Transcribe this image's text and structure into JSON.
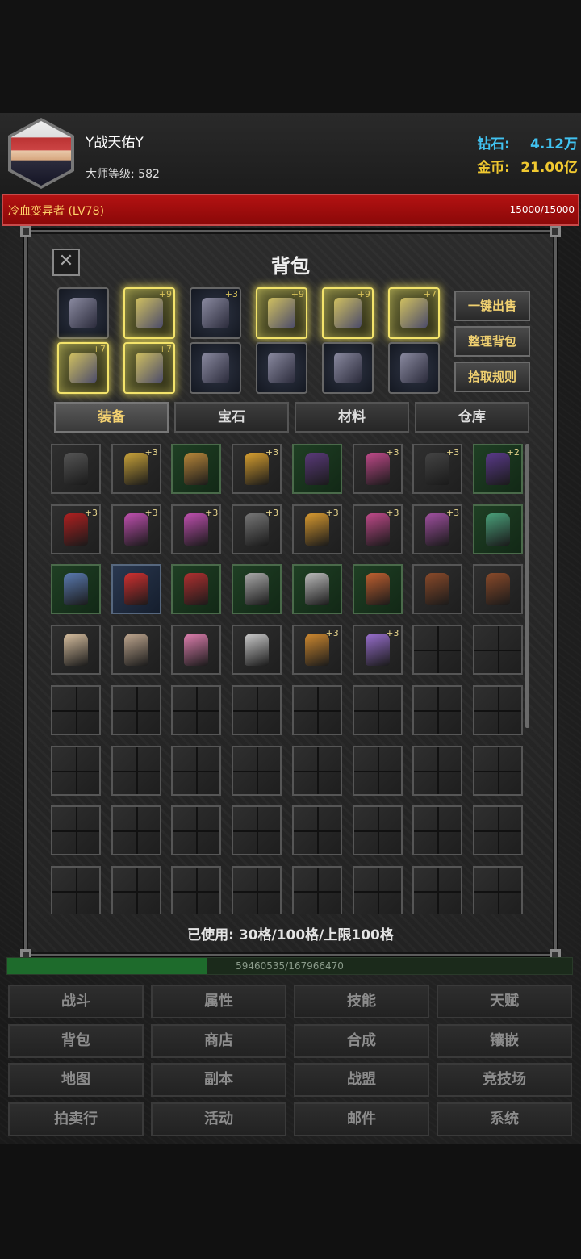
{
  "player": {
    "name": "Y战天佑Y",
    "level_label": "大师等级:",
    "level_value": "582"
  },
  "currency": {
    "diamond_label": "钻石:",
    "diamond_value": "4.12万",
    "gold_label": "金币:",
    "gold_value": "21.00亿",
    "diamond_color": "#41c2f0",
    "gold_color": "#f0c830"
  },
  "enemy": {
    "name": "冷血变异者 (LV78)",
    "hp": "15000/15000"
  },
  "bag": {
    "title": "背包",
    "close_icon": "close-icon",
    "equipped": [
      {
        "name": "helmet",
        "plus": "",
        "glow": false
      },
      {
        "name": "chest-armor",
        "plus": "+9",
        "glow": true
      },
      {
        "name": "leg-armor",
        "plus": "+3",
        "glow": false
      },
      {
        "name": "gloves",
        "plus": "+9",
        "glow": true
      },
      {
        "name": "boots",
        "plus": "+9",
        "glow": true
      },
      {
        "name": "wings",
        "plus": "+7",
        "glow": true
      },
      {
        "name": "weapon-left",
        "plus": "+7",
        "glow": true
      },
      {
        "name": "weapon-right",
        "plus": "+7",
        "glow": true
      },
      {
        "name": "necklace",
        "plus": "",
        "glow": false
      },
      {
        "name": "ring-left",
        "plus": "",
        "glow": false
      },
      {
        "name": "ring-right",
        "plus": "",
        "glow": false
      },
      {
        "name": "pet",
        "plus": "",
        "glow": false
      }
    ],
    "actions": {
      "sell_all": "一键出售",
      "sort": "整理背包",
      "pickup_rules": "拾取规则"
    },
    "tabs": [
      "装备",
      "宝石",
      "材料",
      "仓库"
    ],
    "active_tab": 0,
    "items": [
      {
        "name": "wings",
        "plus": "",
        "bg": "normal",
        "color": "#555"
      },
      {
        "name": "gold-armor",
        "plus": "+3",
        "bg": "normal",
        "color": "#c9a33a"
      },
      {
        "name": "gold-armor",
        "plus": "",
        "bg": "green",
        "color": "#b8873a"
      },
      {
        "name": "helm-gold",
        "plus": "+3",
        "bg": "normal",
        "color": "#d8a030"
      },
      {
        "name": "purple-armor",
        "plus": "",
        "bg": "green",
        "color": "#5a3a7a"
      },
      {
        "name": "pink-armor",
        "plus": "+3",
        "bg": "normal",
        "color": "#c04a8a"
      },
      {
        "name": "dark-pants",
        "plus": "+3",
        "bg": "normal",
        "color": "#444"
      },
      {
        "name": "purple-pants",
        "plus": "+2",
        "bg": "green",
        "color": "#5a3a8a"
      },
      {
        "name": "red-pants",
        "plus": "+3",
        "bg": "normal",
        "color": "#b02020"
      },
      {
        "name": "pink-gloves",
        "plus": "+3",
        "bg": "normal",
        "color": "#c050b0"
      },
      {
        "name": "pink-gloves",
        "plus": "+3",
        "bg": "normal",
        "color": "#c050b0"
      },
      {
        "name": "dark-gloves",
        "plus": "+3",
        "bg": "normal",
        "color": "#777"
      },
      {
        "name": "gold-gloves",
        "plus": "+3",
        "bg": "normal",
        "color": "#d89a30"
      },
      {
        "name": "pink-boots",
        "plus": "+3",
        "bg": "normal",
        "color": "#c04a8a"
      },
      {
        "name": "purple-boots",
        "plus": "+3",
        "bg": "normal",
        "color": "#a050a0"
      },
      {
        "name": "green-claw",
        "plus": "",
        "bg": "green",
        "color": "#4aa07a"
      },
      {
        "name": "blue-claw",
        "plus": "",
        "bg": "green",
        "color": "#5a7ab0"
      },
      {
        "name": "red-ring",
        "plus": "",
        "bg": "blue",
        "color": "#d03030"
      },
      {
        "name": "red-staff",
        "plus": "",
        "bg": "green",
        "color": "#b03030"
      },
      {
        "name": "silver-staff",
        "plus": "",
        "bg": "green",
        "color": "#aaa"
      },
      {
        "name": "silver-axe",
        "plus": "",
        "bg": "green",
        "color": "#bbb"
      },
      {
        "name": "orange-horn",
        "plus": "",
        "bg": "green",
        "color": "#c06030"
      },
      {
        "name": "bow",
        "plus": "",
        "bg": "normal",
        "color": "#8a4a2a"
      },
      {
        "name": "bow",
        "plus": "",
        "bg": "normal",
        "color": "#8a4a2a"
      },
      {
        "name": "wings-light",
        "plus": "",
        "bg": "normal",
        "color": "#d8c0a0"
      },
      {
        "name": "wings-light",
        "plus": "",
        "bg": "normal",
        "color": "#c0a890"
      },
      {
        "name": "pink-staff",
        "plus": "",
        "bg": "normal",
        "color": "#e080b0"
      },
      {
        "name": "bone-crossbow",
        "plus": "",
        "bg": "normal",
        "color": "#ccc"
      },
      {
        "name": "gold-boots",
        "plus": "+3",
        "bg": "normal",
        "color": "#d08a30"
      },
      {
        "name": "purple-bow",
        "plus": "+3",
        "bg": "normal",
        "color": "#9a70d0"
      }
    ],
    "total_cells": 64,
    "usage": "已使用: 30格/100格/上限100格"
  },
  "exp": {
    "text": "59460535/167966470",
    "fraction": 0.354
  },
  "menu": [
    "战斗",
    "属性",
    "技能",
    "天赋",
    "背包",
    "商店",
    "合成",
    "镶嵌",
    "地图",
    "副本",
    "战盟",
    "竞技场",
    "拍卖行",
    "活动",
    "邮件",
    "系统"
  ]
}
